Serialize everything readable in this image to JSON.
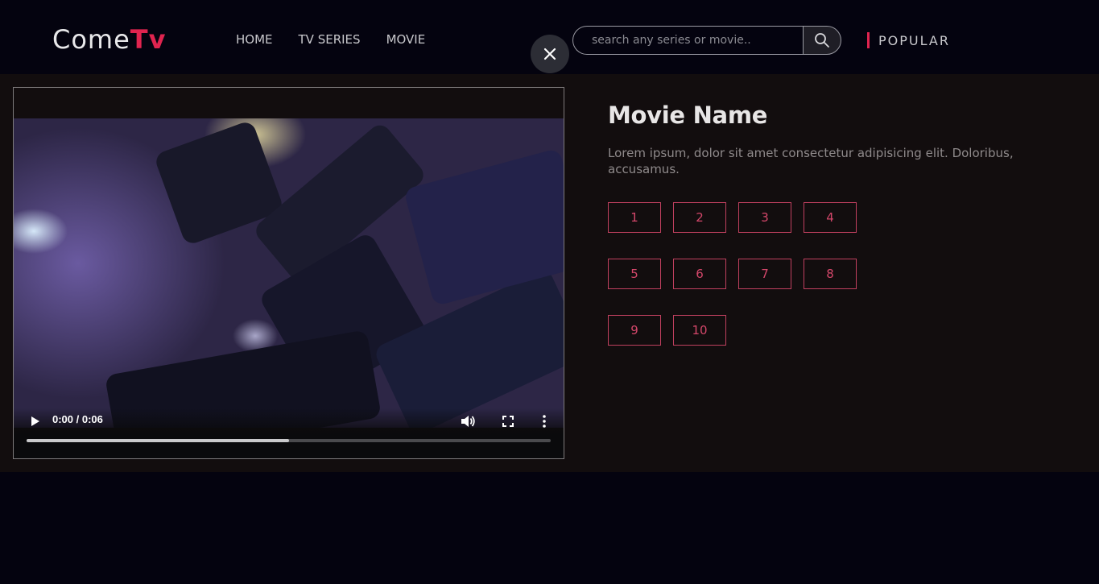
{
  "header": {
    "logo_main": "Come",
    "logo_accent": "Tv",
    "nav": [
      {
        "label": "HOME"
      },
      {
        "label": "TV SERIES"
      },
      {
        "label": "MOVIE"
      }
    ],
    "search": {
      "placeholder": "search any series or movie.."
    },
    "popular_label": "POPULAR"
  },
  "player": {
    "time": "0:00 / 0:06",
    "progress_fraction": 0.5
  },
  "movie": {
    "title": "Movie Name",
    "description": "Lorem ipsum, dolor sit amet consectetur adipisicing elit. Doloribus, accusamus.",
    "episodes": [
      "1",
      "2",
      "3",
      "4",
      "5",
      "6",
      "7",
      "8",
      "9",
      "10"
    ]
  },
  "colors": {
    "accent": "#e0244f",
    "background": "#04030f",
    "panel": "#120d0e"
  }
}
